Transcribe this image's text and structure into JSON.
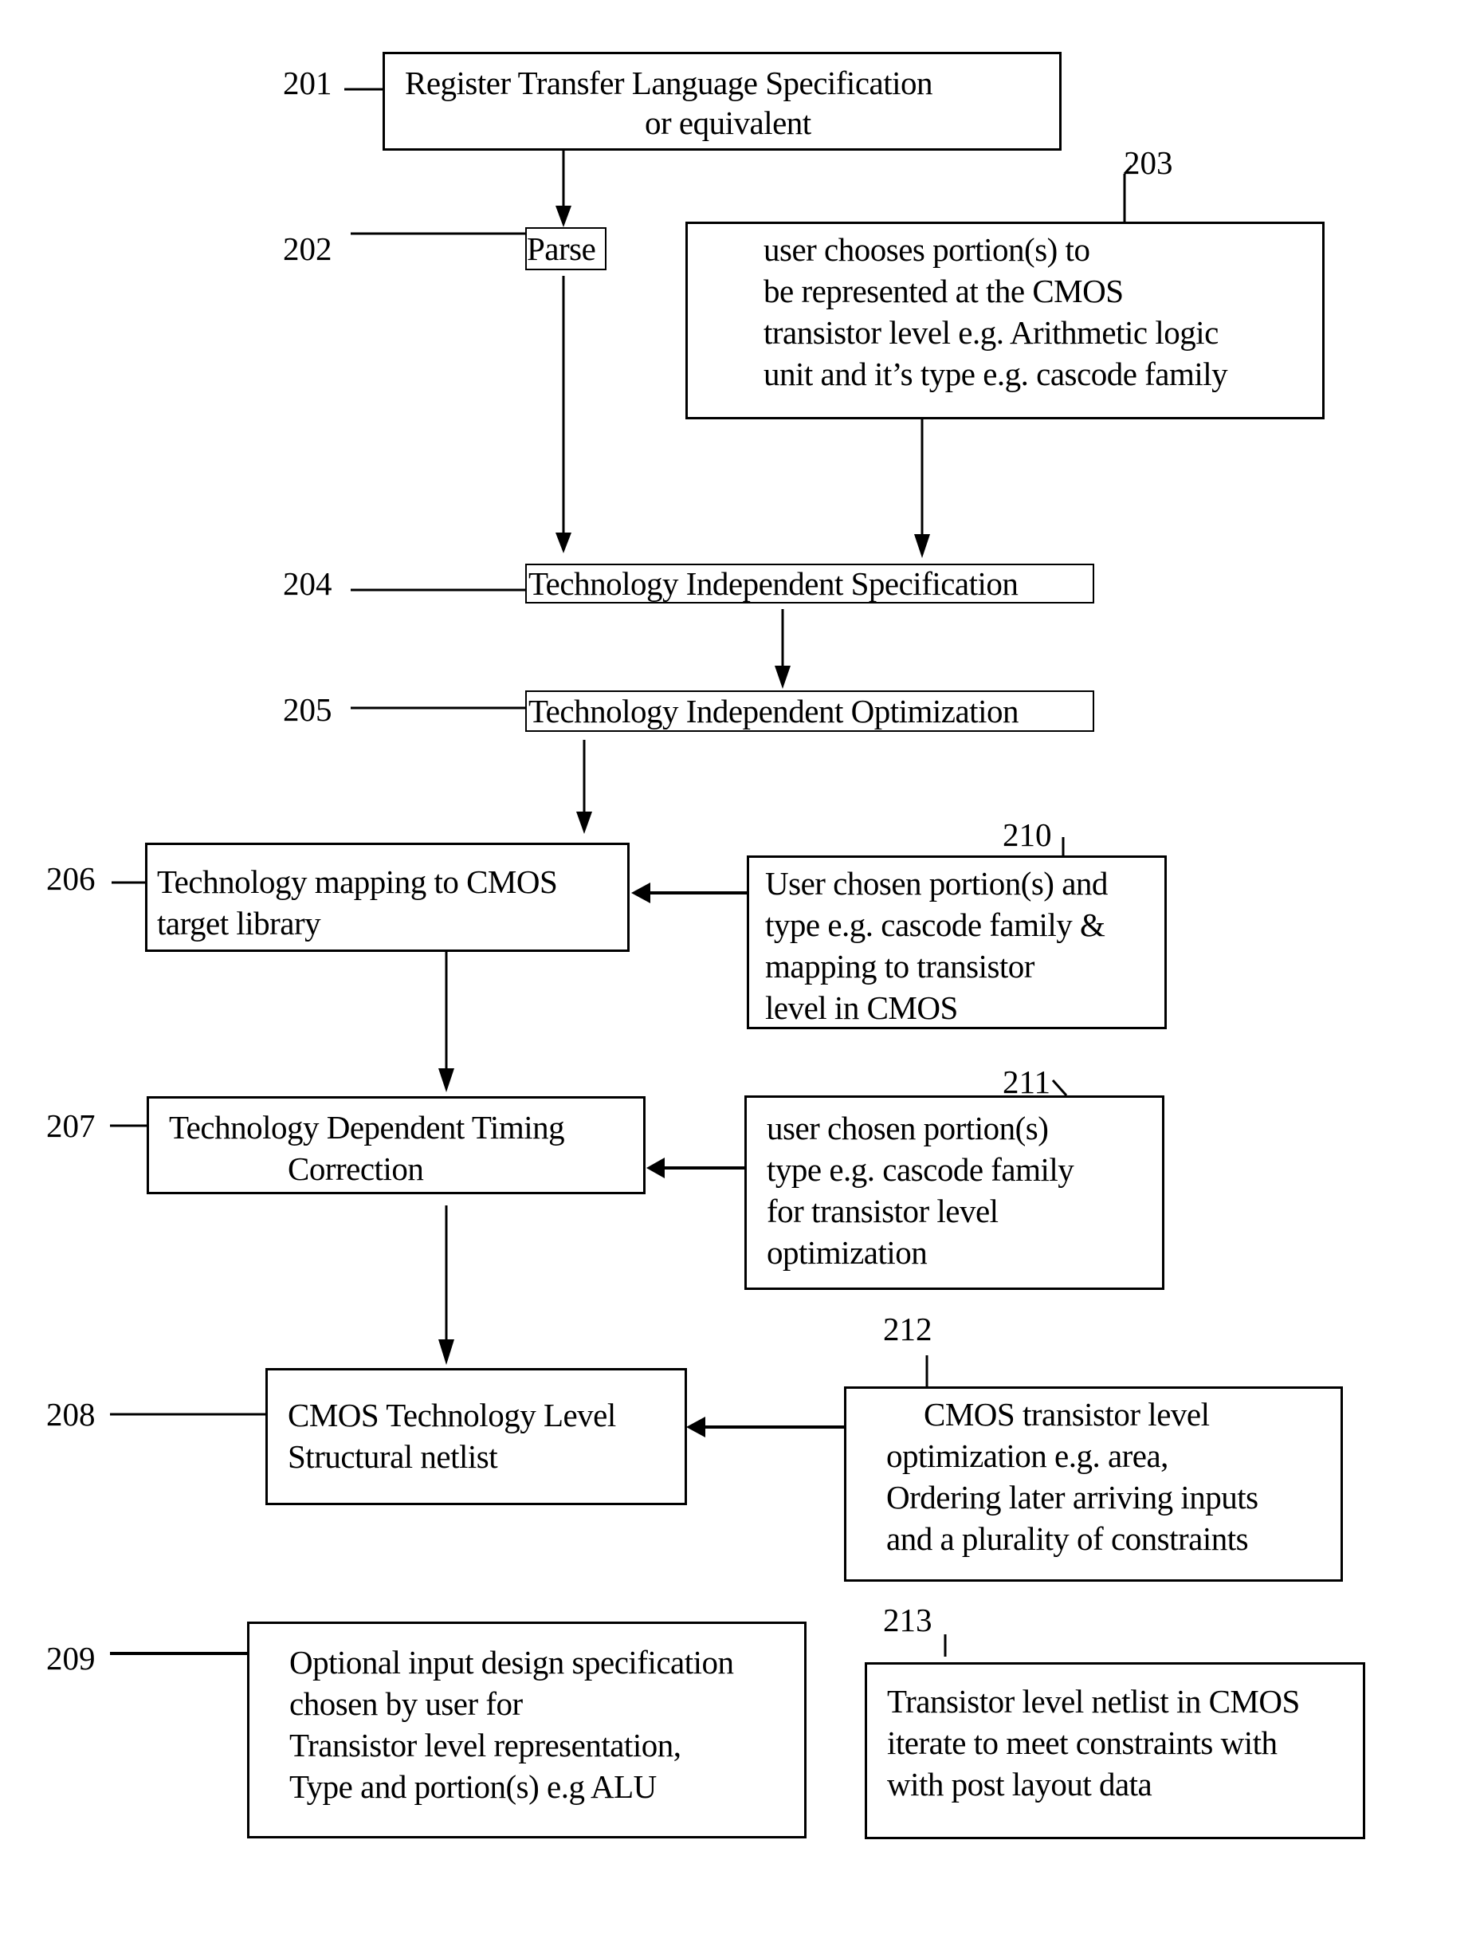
{
  "diagram": {
    "type": "flowchart",
    "nodes": [
      {
        "id": "201",
        "ref": "201",
        "lines": [
          "Register Transfer Language Specification",
          "or equivalent"
        ]
      },
      {
        "id": "202",
        "ref": "202",
        "lines": [
          "Parse"
        ]
      },
      {
        "id": "203",
        "ref": "203",
        "lines": [
          "user chooses portion(s) to",
          "be represented at the CMOS",
          "transistor level e.g. Arithmetic logic",
          "unit and it’s type e.g. cascode family"
        ]
      },
      {
        "id": "204",
        "ref": "204",
        "lines": [
          "Technology Independent Specification"
        ]
      },
      {
        "id": "205",
        "ref": "205",
        "lines": [
          "Technology Independent Optimization"
        ]
      },
      {
        "id": "206",
        "ref": "206",
        "lines": [
          "Technology mapping to CMOS",
          " target library"
        ]
      },
      {
        "id": "210",
        "ref": "210",
        "lines": [
          "User chosen portion(s) and",
          "type e.g. cascode family &",
          "mapping to transistor",
          "level in CMOS"
        ]
      },
      {
        "id": "207",
        "ref": "207",
        "lines": [
          "Technology Dependent Timing",
          "Correction"
        ]
      },
      {
        "id": "211",
        "ref": "211",
        "lines": [
          "user chosen portion(s)",
          "type e.g. cascode family",
          "for transistor level",
          "optimization"
        ]
      },
      {
        "id": "208",
        "ref": "208",
        "lines": [
          "CMOS Technology Level",
          "Structural netlist"
        ]
      },
      {
        "id": "212",
        "ref": "212",
        "lines": [
          "CMOS transistor level",
          "optimization e.g. area,",
          "Ordering later arriving inputs",
          "and a plurality of constraints"
        ]
      },
      {
        "id": "209",
        "ref": "209",
        "lines": [
          "Optional input design specification",
          "chosen by user for",
          "Transistor level representation,",
          "Type and portion(s) e.g ALU"
        ]
      },
      {
        "id": "213",
        "ref": "213",
        "lines": [
          "Transistor level netlist in CMOS",
          "iterate to meet constraints with",
          "with post layout data"
        ]
      }
    ],
    "edges": [
      {
        "from": "201",
        "to": "202"
      },
      {
        "from": "202",
        "to": "204"
      },
      {
        "from": "203",
        "to": "204"
      },
      {
        "from": "204",
        "to": "205"
      },
      {
        "from": "205",
        "to": "206"
      },
      {
        "from": "210",
        "to": "206"
      },
      {
        "from": "206",
        "to": "207"
      },
      {
        "from": "211",
        "to": "207"
      },
      {
        "from": "207",
        "to": "208"
      },
      {
        "from": "212",
        "to": "208"
      }
    ]
  }
}
